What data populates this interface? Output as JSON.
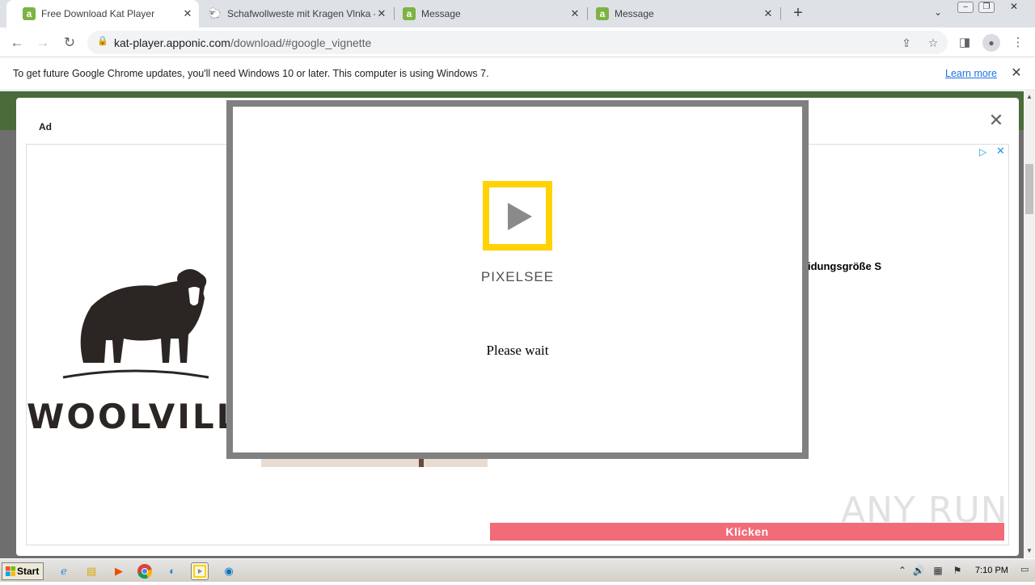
{
  "browser": {
    "tabs": [
      {
        "title": "Free Download Kat Player",
        "favicon": "a",
        "active": true
      },
      {
        "title": "Schafwollweste mit Kragen Vlnka - W",
        "favicon": "sheep-icon",
        "active": false
      },
      {
        "title": "Message",
        "favicon": "a",
        "active": false
      },
      {
        "title": "Message",
        "favicon": "a",
        "active": false
      }
    ],
    "new_tab_label": "+",
    "url_host": "kat-player.apponic.com",
    "url_path": "/download/#google_vignette"
  },
  "infobar": {
    "message": "To get future Google Chrome updates, you'll need Windows 10 or later. This computer is using Windows 7.",
    "link": "Learn more"
  },
  "ad": {
    "label": "Ad",
    "brand_name": "WOOLVILL",
    "product_title_fragment": "idungsgröße S",
    "cta_label": "Klicken",
    "cta_color": "#f26b79"
  },
  "dialog": {
    "brand": "PIXELSEE",
    "message": "Please wait",
    "logo_color": "#ffd200"
  },
  "watermark": "ANY RUN",
  "taskbar": {
    "start_label": "Start",
    "clock": "7:10 PM"
  }
}
